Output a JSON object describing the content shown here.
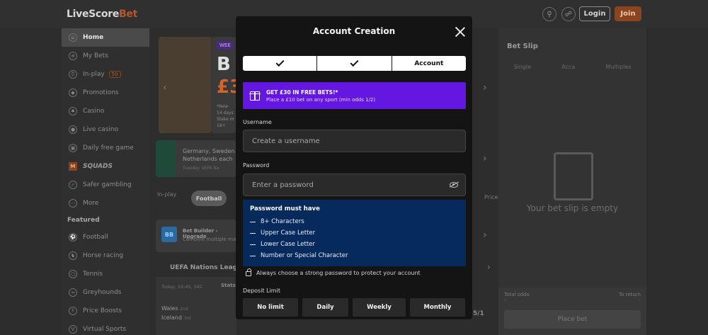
{
  "header": {
    "logo_main": "LiveScore",
    "logo_accent": "Bet",
    "login_label": "Login",
    "join_label": "Join"
  },
  "sidebar": {
    "items": [
      {
        "label": "Home",
        "icon": "home-icon"
      },
      {
        "label": "My Bets",
        "icon": "mybets-icon"
      },
      {
        "label": "In-play",
        "icon": "stopwatch-icon",
        "tag": "50"
      },
      {
        "label": "Promotions",
        "icon": "tag-icon"
      },
      {
        "label": "Casino",
        "icon": "casino-icon"
      },
      {
        "label": "Live casino",
        "icon": "live-casino-icon"
      },
      {
        "label": "Daily free game",
        "icon": "cart-icon"
      },
      {
        "label": "SQUADS",
        "icon": "squads-icon"
      },
      {
        "label": "Safer gambling",
        "icon": "shield-icon"
      },
      {
        "label": "More",
        "icon": "more-icon"
      }
    ],
    "featured_title": "Featured",
    "featured": [
      {
        "label": "Football",
        "icon": "football-icon"
      },
      {
        "label": "Horse racing",
        "icon": "horse-icon"
      },
      {
        "label": "Tennis",
        "icon": "tennis-icon"
      },
      {
        "label": "Greyhounds",
        "icon": "greyhound-icon"
      },
      {
        "label": "Price Boosts",
        "icon": "boost-icon"
      },
      {
        "label": "Virtual Sports",
        "icon": "virtual-icon"
      }
    ]
  },
  "background": {
    "promo_badge": "WEE",
    "promo_big": "B",
    "promo_pound": "£3",
    "promo_new": "*New",
    "promo_lines": [
      "14 days",
      "Stake m",
      "18+"
    ],
    "match_line1": "Germany, Sweden",
    "match_line2": "Netherlands each",
    "match_date": "Tuesday UEFA Na",
    "filter_inplay": "In-play",
    "filter_football": "Football",
    "filter_price": "Price",
    "bb_title": "Bet Builder - Upgrade",
    "bb_sub": "Combine multiple ma",
    "bb_badge": "BB",
    "league": "UEFA Nations League",
    "fixture_time": "Today, 19:45, S4C",
    "fixture_stats": "Stats",
    "team1": "Wales",
    "team1_pos": "2nd",
    "team2": "Iceland",
    "team2_pos": "3rd",
    "fixture_odds": "5/1"
  },
  "bet_slip": {
    "title": "Bet Slip",
    "tabs": [
      "Single",
      "Acca",
      "Multiples"
    ],
    "empty_text": "Your bet slip is empty",
    "total_odds_label": "Total odds",
    "total_odds_value": "-",
    "to_return_label": "To return",
    "to_return_value": "-",
    "place_bet_label": "Place bet"
  },
  "modal": {
    "title": "Account Creation",
    "steps": [
      {
        "label": "",
        "done": true
      },
      {
        "label": "",
        "done": true
      },
      {
        "label": "Account",
        "done": false
      }
    ],
    "banner_title": "GET £30 IN FREE BETS!*",
    "banner_sub": "Place a £10 bet on any sport (min odds 1/2)",
    "username_label": "Username",
    "username_placeholder": "Create a username",
    "password_label": "Password",
    "password_placeholder": "Enter a password",
    "rules_title": "Password must have",
    "rules": [
      "8+ Characters",
      "Upper Case Letter",
      "Lower Case Letter",
      "Number or Special Character"
    ],
    "strong_note": "Always choose a strong password to protect your account",
    "deposit_label": "Deposit Limit",
    "limits": [
      "No limit",
      "Daily",
      "Weekly",
      "Monthly"
    ]
  }
}
